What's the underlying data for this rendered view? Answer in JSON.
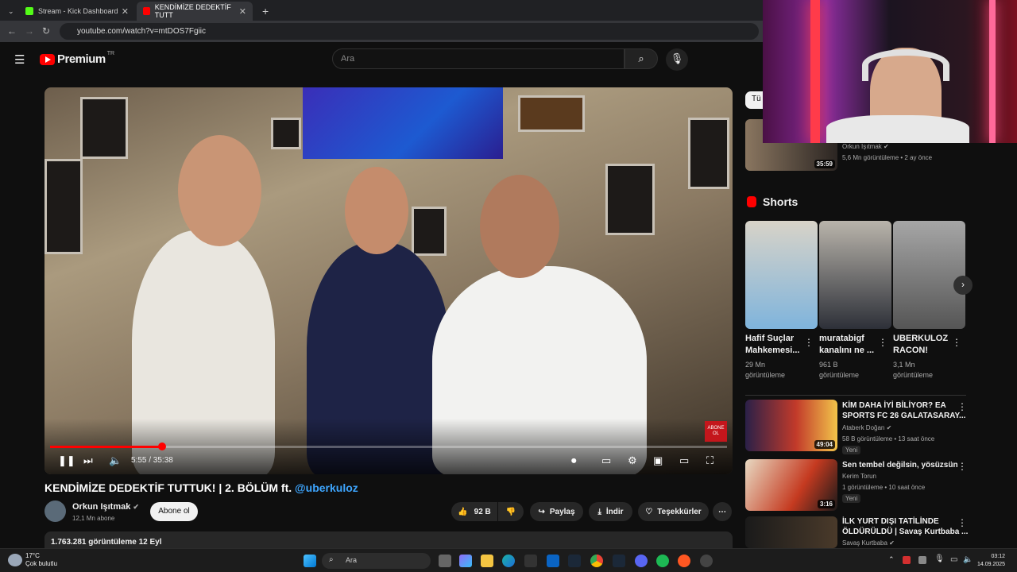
{
  "browser": {
    "tabs": [
      {
        "label": "Stream - Kick Dashboard",
        "color": "#53fc18"
      },
      {
        "label": "KENDİMİZE DEDEKTİF TUTT",
        "color": "#ff0000"
      }
    ],
    "url": "youtube.com/watch?v=mtDOS7Fgiic"
  },
  "header": {
    "logo_text": "Premium",
    "logo_sup": "TR",
    "search_placeholder": "Ara"
  },
  "player": {
    "time": "5:55 / 35:38",
    "progress": 0.166,
    "badge": "ABONE OL"
  },
  "video": {
    "title": "KENDİMİZE DEDEKTİF TUTTUK! | 2. BÖLÜM ft.",
    "title_link": "@uberkuloz",
    "channel": "Orkun Işıtmak",
    "subs": "12,1 Mn abone",
    "subscribe": "Abone ol",
    "likes": "92 B",
    "share": "Paylaş",
    "download": "İndir",
    "thanks": "Teşekkürler",
    "views_date": "1.763.281 görüntüleme  12 Eyl"
  },
  "sidebar": {
    "chip": "Tü",
    "top_video": {
      "channel": "Orkun Işıtmak",
      "meta": "5,6 Mn görüntüleme • 2 ay önce",
      "duration": "35:59"
    },
    "shorts_label": "Shorts",
    "shorts": [
      {
        "title1": "Hafif Suçlar",
        "title2": "Mahkemesi...",
        "views1": "29 Mn",
        "views2": "görüntüleme"
      },
      {
        "title1": "muratabigf",
        "title2": "kanalını ne ...",
        "views1": "961 B",
        "views2": "görüntüleme"
      },
      {
        "title1": "UBERKULOZ",
        "title2": "RACON!",
        "views1": "3,1 Mn",
        "views2": "görüntüleme"
      }
    ],
    "videos": [
      {
        "title1": "KİM DAHA İYİ BİLİYOR? EA",
        "title2": "SPORTS FC 26 GALATASARAY...",
        "channel": "Ataberk Doğan",
        "meta": "58 B görüntüleme • 13 saat önce",
        "badge": "Yeni",
        "duration": "49:04"
      },
      {
        "title1": "Sen tembel değilsin, yösüzsün",
        "title2": "",
        "channel": "Kerim Torun",
        "meta": "1 görüntüleme • 10 saat önce",
        "badge": "Yeni",
        "duration": "3:16"
      },
      {
        "title1": "İLK YURT DIŞI TATİLİNDE",
        "title2": "ÖLDÜRÜLDÜ | Savaş Kurtbaba ...",
        "channel": "Savaş Kurtbaba",
        "meta": "",
        "badge": "",
        "duration": ""
      }
    ]
  },
  "taskbar": {
    "temp": "17°C",
    "weather": "Çok bulutlu",
    "search": "Ara",
    "time": "03:12",
    "date": "14.09.2025"
  }
}
